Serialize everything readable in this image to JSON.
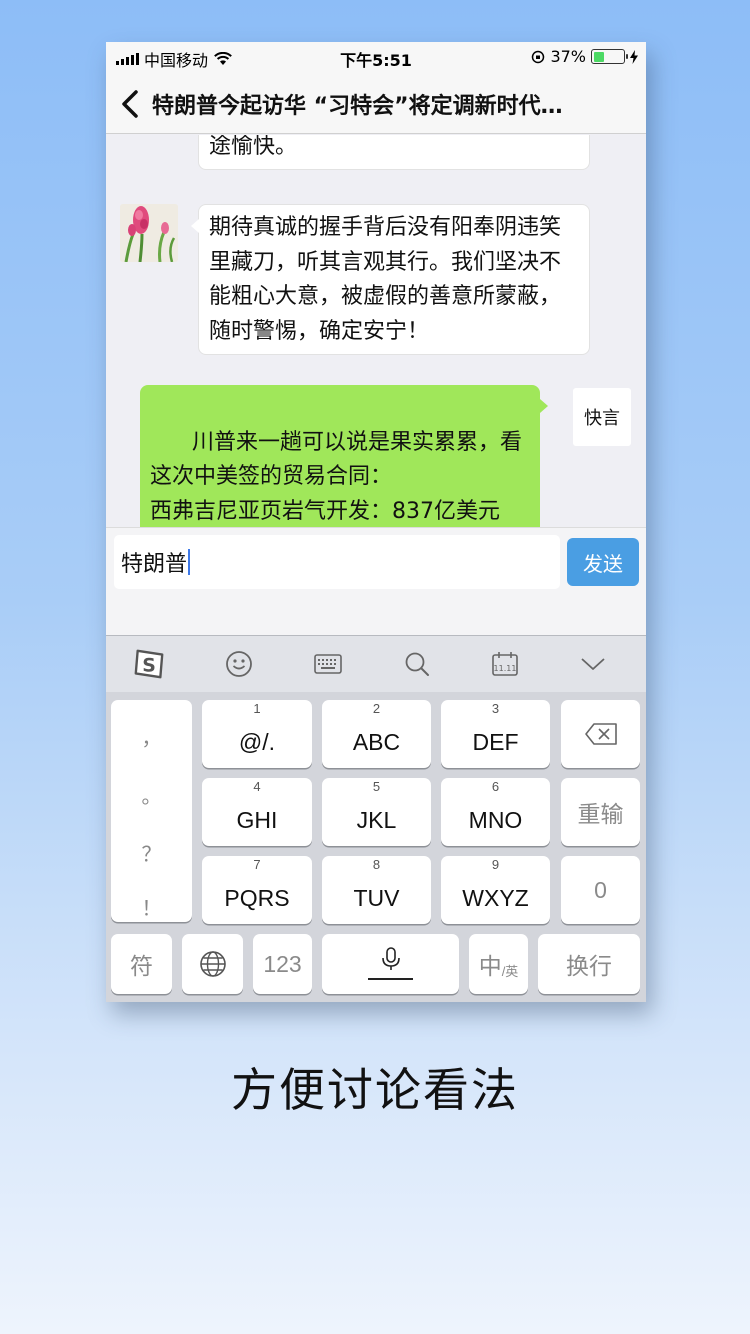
{
  "status_bar": {
    "carrier": "中国移动",
    "time": "下午5:51",
    "battery_percent": "37%",
    "battery_level": 0.37
  },
  "nav": {
    "title": "特朗普今起访华 “习特会”将定调新时代…"
  },
  "chat": {
    "messages": [
      {
        "side": "left",
        "text": "途愉快。"
      },
      {
        "side": "left",
        "text": "期待真诚的握手背后没有阳奉阴违笑里藏刀，听其言观其行。我们坚决不能粗心大意，被虚假的善意所蒙蔽，随时警惕，确定安宁！"
      },
      {
        "side": "right",
        "text": "川普来一趟可以说是果实累累，看这次中美签的贸易合同：\n西弗吉尼亚页岩气开发：837亿美元",
        "avatar_text": "快言"
      }
    ]
  },
  "input": {
    "value": "特朗普",
    "send_label": "发送"
  },
  "keyboard": {
    "toolbar_icons": [
      "sogou-logo-icon",
      "emoji-icon",
      "keyboard-icon",
      "search-icon",
      "calendar-icon",
      "collapse-icon"
    ],
    "punctuation": [
      "，",
      "。",
      "？",
      "！"
    ],
    "keys": [
      {
        "num": "1",
        "label": "@/."
      },
      {
        "num": "2",
        "label": "ABC"
      },
      {
        "num": "3",
        "label": "DEF"
      },
      {
        "num": "4",
        "label": "GHI"
      },
      {
        "num": "5",
        "label": "JKL"
      },
      {
        "num": "6",
        "label": "MNO"
      },
      {
        "num": "7",
        "label": "PQRS"
      },
      {
        "num": "8",
        "label": "TUV"
      },
      {
        "num": "9",
        "label": "WXYZ"
      }
    ],
    "reinput_label": "重输",
    "zero_label": "0",
    "symbol_label": "符",
    "num_label": "123",
    "lang_main": "中",
    "lang_sub": "/英",
    "enter_label": "换行"
  },
  "caption": "方便讨论看法",
  "colors": {
    "green_bubble": "#a0e75a",
    "send_button": "#4a9ee3",
    "background_top": "#8dbdf7"
  }
}
